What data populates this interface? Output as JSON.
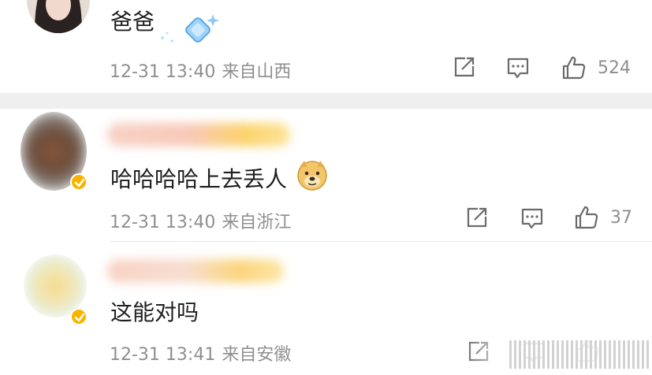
{
  "comments": [
    {
      "text": "爸爸",
      "time": "12-31 13:40",
      "location": "来自山西",
      "likes": "524",
      "verified": false,
      "emoji": "diamond-badge-icon"
    },
    {
      "text": "哈哈哈哈上去丢人",
      "time": "12-31 13:40",
      "location": "来自浙江",
      "likes": "37",
      "verified": true,
      "emoji": "doge-emoji-icon"
    },
    {
      "text": "这能对吗",
      "time": "12-31 13:41",
      "location": "来自安徽",
      "likes": "",
      "verified": true
    }
  ],
  "icons": {
    "share": "share-icon",
    "comment": "comment-icon",
    "like": "like-icon",
    "verified": "verified-badge-icon"
  },
  "colors": {
    "text": "#1f1f1f",
    "meta": "#8f8f8f",
    "icon": "#6b6b6b",
    "verified": "#f7b500",
    "separator": "#efefef"
  }
}
